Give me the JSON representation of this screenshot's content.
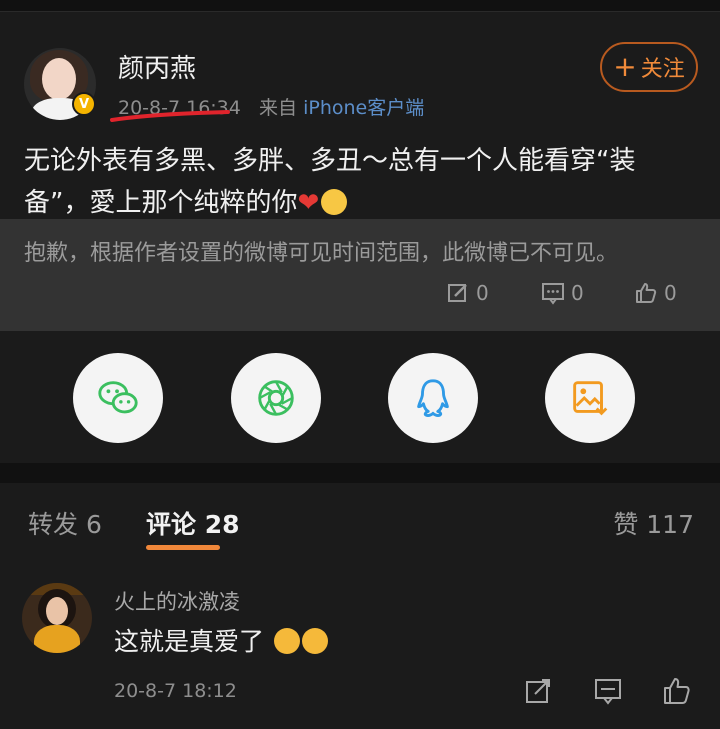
{
  "post": {
    "author": "颜丙燕",
    "time": "20-8-7 16:34",
    "source_prefix": "来自",
    "source": "iPhone客户端",
    "follow_label": "关注",
    "text_before_emoji": "无论外表有多黑、多胖、多丑～总有一个人能看穿“装备”，愛上那个纯粹的你",
    "heart_emoji": "❤"
  },
  "retweet_hidden": {
    "message": "抱歉，根据作者设置的微博可见时间范围，此微博已不可见。",
    "reposts": "0",
    "comments": "0",
    "likes": "0"
  },
  "share": {
    "items": [
      "wechat-icon",
      "moments-icon",
      "qq-icon",
      "save-image-icon"
    ]
  },
  "tabs": {
    "reposts_label": "转发",
    "reposts_count": "6",
    "comments_label": "评论",
    "comments_count": "28",
    "likes_label": "赞",
    "likes_count": "117"
  },
  "comment": {
    "name": "火上的冰激凌",
    "text": "这就是真爱了",
    "time": "20-8-7 18:12"
  },
  "colors": {
    "background": "#1b1b1b",
    "accent_orange": "#f0873a",
    "link_blue": "#5c8ec9",
    "hidden_box": "#333333"
  }
}
